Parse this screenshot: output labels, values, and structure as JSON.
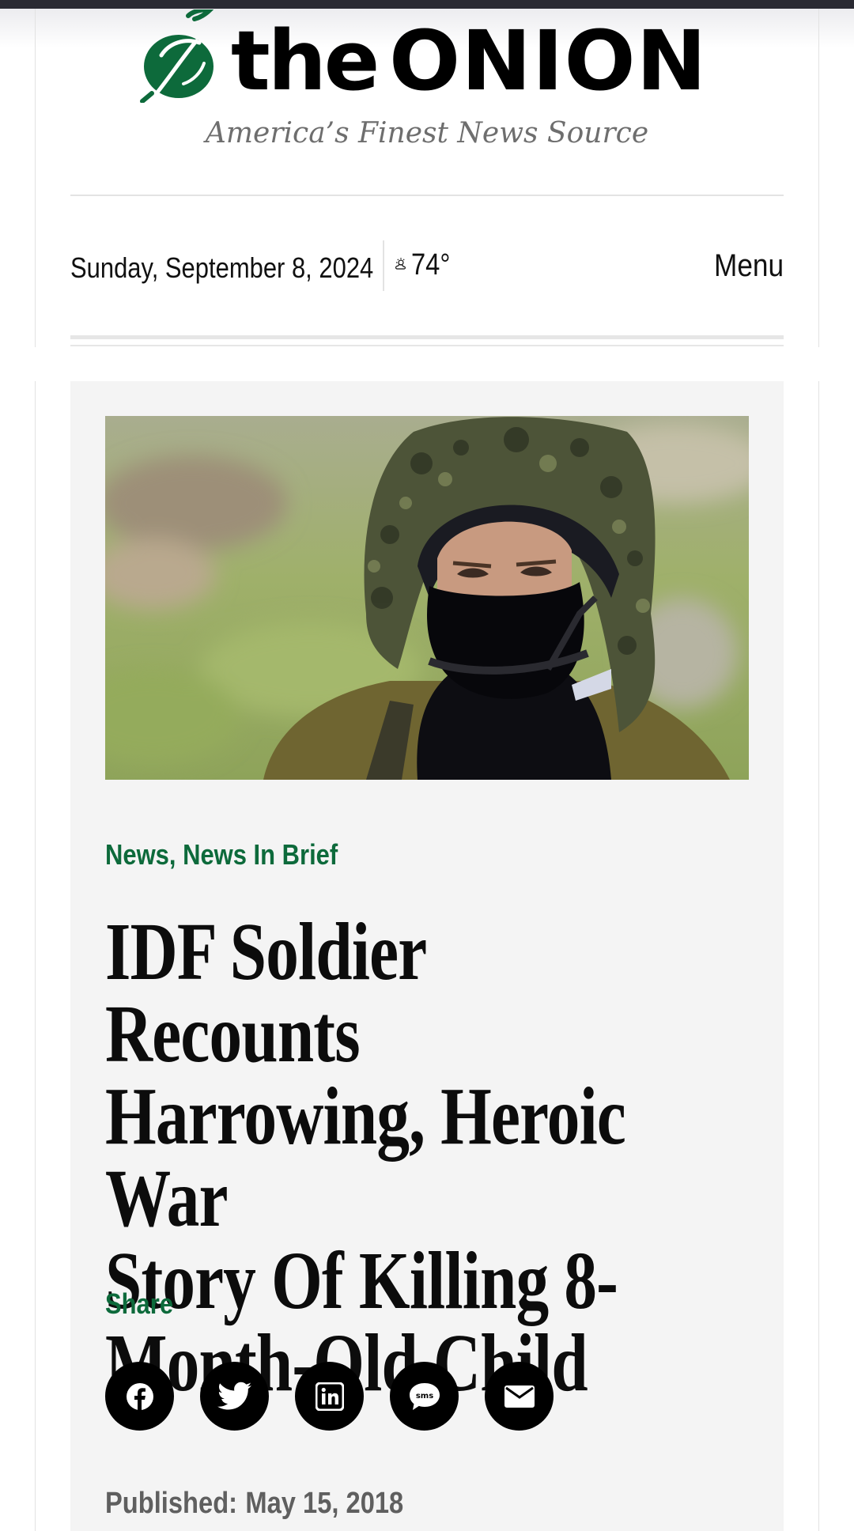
{
  "site": {
    "logo_the": "the",
    "logo_onion": "ONION",
    "tagline": "America’s Finest News Source",
    "brand_green": "#0d6a3b"
  },
  "header": {
    "date": "Sunday, September 8, 2024",
    "weather_icon": "partly-cloudy-icon",
    "temperature": "74°",
    "menu_label": "Menu"
  },
  "article": {
    "categories": "News, News In Brief",
    "headline_lines": [
      "IDF Soldier Recounts",
      "Harrowing, Heroic War",
      "Story Of Killing 8-",
      "Month-Old Child"
    ],
    "share_label": "Share",
    "share_buttons": [
      {
        "icon": "facebook-icon"
      },
      {
        "icon": "twitter-icon"
      },
      {
        "icon": "linkedin-icon"
      },
      {
        "icon": "sms-icon",
        "text": "sms"
      },
      {
        "icon": "email-icon"
      }
    ],
    "published_label": "Published:",
    "published_date": "May 15, 2018"
  }
}
